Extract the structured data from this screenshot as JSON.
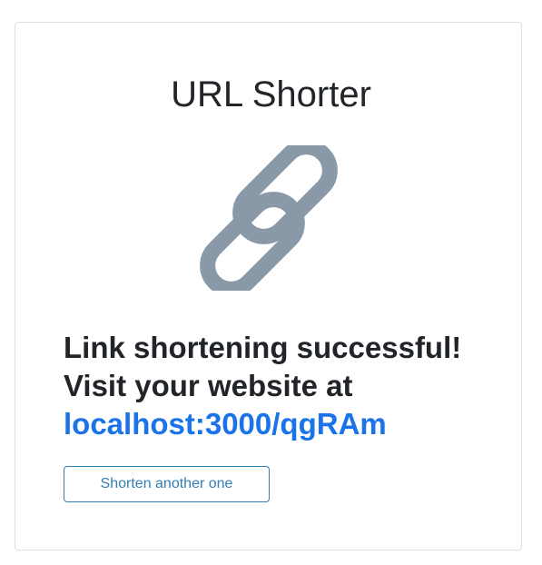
{
  "card": {
    "title": "URL Shorter",
    "icon": "link-icon",
    "message_line1": "Link shortening successful!",
    "message_line2": "Visit your website at",
    "short_url": "localhost:3000/qgRAm",
    "button_label": "Shorten another one"
  },
  "colors": {
    "icon": "#8a99a8",
    "link": "#1a73e8",
    "button_border": "#2f7fb4"
  }
}
